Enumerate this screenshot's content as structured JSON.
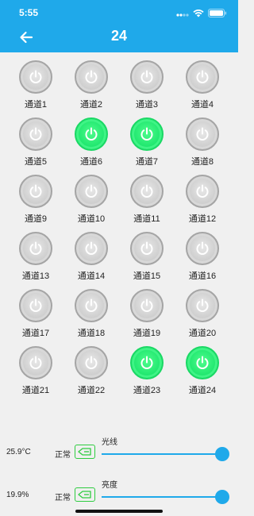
{
  "status_bar": {
    "time": "5:55",
    "colors": {
      "text": "#ffffff"
    }
  },
  "header": {
    "title": "24",
    "back_icon": "arrow-left-icon",
    "bg_color": "#1fa9ea"
  },
  "channels": [
    {
      "label": "通道1",
      "on": false
    },
    {
      "label": "通道2",
      "on": false
    },
    {
      "label": "通道3",
      "on": false
    },
    {
      "label": "通道4",
      "on": false
    },
    {
      "label": "通道5",
      "on": false
    },
    {
      "label": "通道6",
      "on": true
    },
    {
      "label": "通道7",
      "on": true
    },
    {
      "label": "通道8",
      "on": false
    },
    {
      "label": "通道9",
      "on": false
    },
    {
      "label": "通道10",
      "on": false
    },
    {
      "label": "通道11",
      "on": false
    },
    {
      "label": "通道12",
      "on": false
    },
    {
      "label": "通道13",
      "on": false
    },
    {
      "label": "通道14",
      "on": false
    },
    {
      "label": "通道15",
      "on": false
    },
    {
      "label": "通道16",
      "on": false
    },
    {
      "label": "通道17",
      "on": false
    },
    {
      "label": "通道18",
      "on": false
    },
    {
      "label": "通道19",
      "on": false
    },
    {
      "label": "通道20",
      "on": false
    },
    {
      "label": "通道21",
      "on": false
    },
    {
      "label": "通道22",
      "on": false
    },
    {
      "label": "通道23",
      "on": true
    },
    {
      "label": "通道24",
      "on": true
    }
  ],
  "sensors": [
    {
      "value": "25.9°C",
      "status": "正常",
      "name": "光线",
      "icon": "signal-tag-icon",
      "slider_fraction": 1.0
    },
    {
      "value": "19.9%",
      "status": "正常",
      "name": "亮度",
      "icon": "signal-tag-icon",
      "slider_fraction": 1.0
    }
  ],
  "colors": {
    "on": "#22e870",
    "off": "#cfcfcf",
    "accent": "#1fa9ea",
    "icon_green": "#2ecc40"
  }
}
